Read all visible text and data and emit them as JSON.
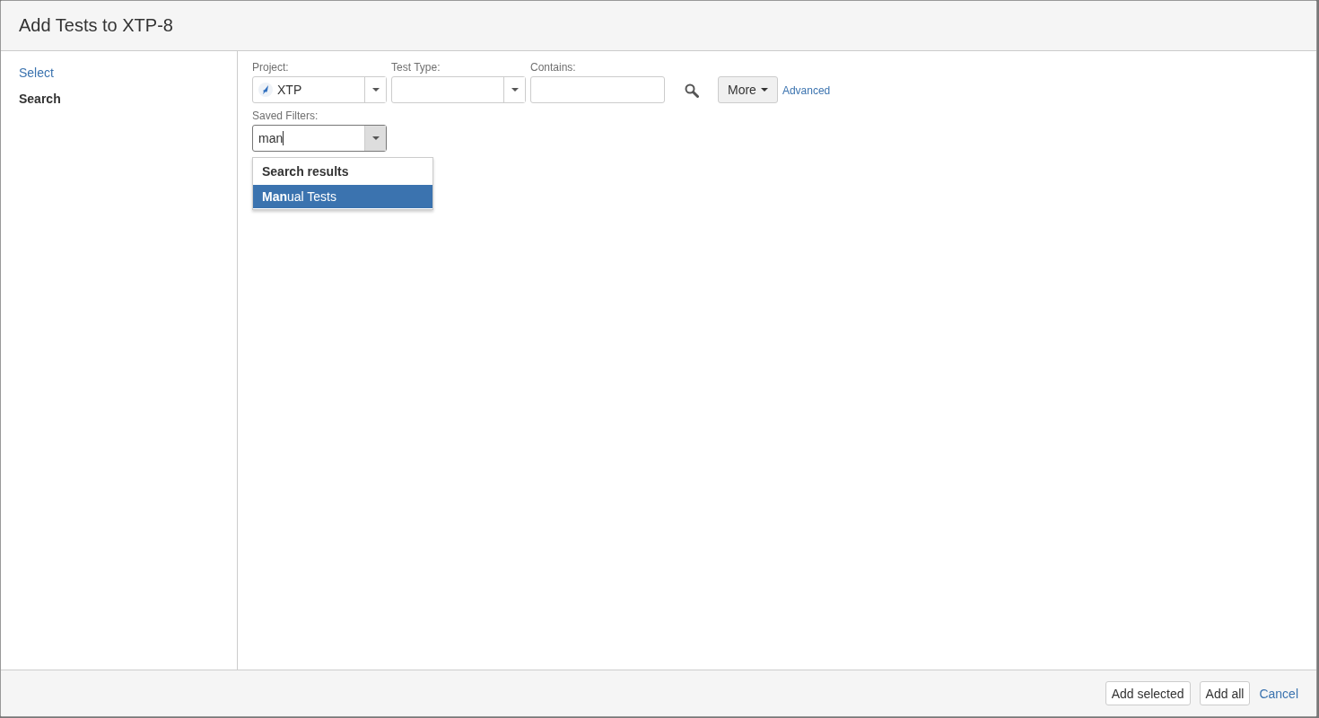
{
  "dialog": {
    "title": "Add Tests to XTP-8"
  },
  "sidebar": {
    "items": [
      {
        "label": "Select",
        "selected": false
      },
      {
        "label": "Search",
        "selected": true
      }
    ]
  },
  "filters": {
    "project": {
      "label": "Project:",
      "value": "XTP"
    },
    "test_type": {
      "label": "Test Type:"
    },
    "contains": {
      "label": "Contains:"
    },
    "more_button": "More",
    "advanced_link": "Advanced",
    "saved_filters": {
      "label": "Saved Filters:",
      "value": "man",
      "dropdown": {
        "heading": "Search results",
        "options": [
          {
            "label": "**Man**ual Tests",
            "selected": true
          }
        ]
      }
    }
  },
  "footer": {
    "buttons": [
      "Add selected",
      "Add all"
    ],
    "cancel_link": "Cancel"
  }
}
